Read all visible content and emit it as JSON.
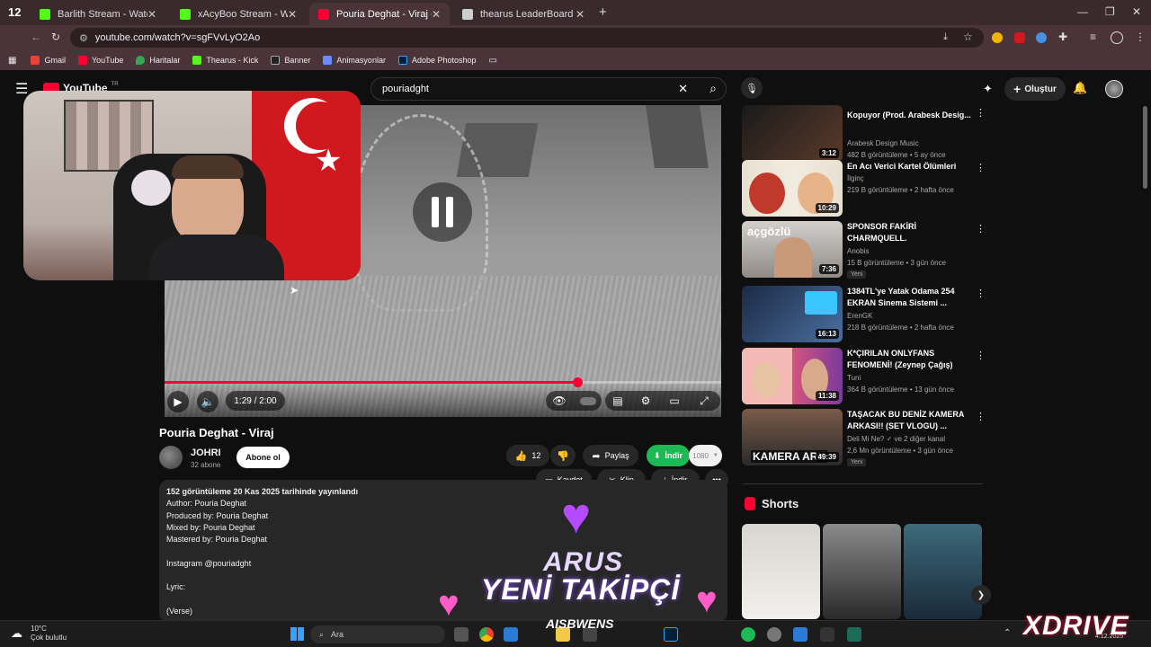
{
  "browser": {
    "tabs": [
      {
        "title": "Barlith Stream - Watch Live on",
        "color": "#53fc18"
      },
      {
        "title": "xAcyBoo Stream - Watch Live o",
        "color": "#53fc18"
      },
      {
        "title": "Pouria Deghat - Viraj - YouT",
        "color": "#ff0033"
      },
      {
        "title": "thearus LeaderBoard | The best",
        "color": "#cccccc"
      }
    ],
    "url": "youtube.com/watch?v=sgFVvLyO2Ao",
    "bookmarks": [
      "Gmail",
      "YouTube",
      "Haritalar",
      "Thearus - Kick",
      "Banner",
      "Animasyonlar",
      "Adobe Photoshop"
    ],
    "tab_counter": "12"
  },
  "youtube": {
    "logo": "YouTube",
    "logo_region": "TR",
    "search_value": "pouriadght",
    "create_label": "Oluştur"
  },
  "player": {
    "time": "1:29 / 2:00",
    "progress": 0.742
  },
  "video": {
    "title": "Pouria Deghat - Viraj",
    "channel": "JOHRI",
    "subscribers": "32 abone",
    "subscribe_label": "Abone ol",
    "likes": "12",
    "share_label": "Paylaş",
    "download_green_label": "İndir",
    "quality": "1080",
    "save_label": "Kaydet",
    "clip_label": "Klip",
    "download_label": "İndir"
  },
  "description": {
    "meta": "152 görüntüleme  20 Kas 2025 tarihinde yayınlandı",
    "lines": [
      "Author: Pouria Deghat",
      "Produced by: Pouria Deghat",
      "Mixed by: Pouria Deghat",
      "Mastered by: Pouria Deghat",
      "",
      "Instagram @pouriadght",
      "",
      "Lyric:",
      "",
      "(Verse)"
    ]
  },
  "alert": {
    "name": "ARUS",
    "text": "YENİ TAKİPÇİ",
    "sub": "AISBWENS"
  },
  "recommendations": [
    {
      "title": "Kopuyor (Prod. Arabesk Desig...",
      "channel": "Arabesk Design Music",
      "stats": "482 B görüntüleme • 5 ay önce",
      "duration": "3:12",
      "badge": ""
    },
    {
      "title": "En Acı Verici Kartel Ölümleri",
      "channel": "İlginç",
      "stats": "219 B görüntüleme • 2 hafta önce",
      "duration": "10:29",
      "badge": ""
    },
    {
      "title": "SPONSOR FAKİRİ CHARMQUELL.",
      "channel": "Anobis",
      "stats": "15 B görüntüleme • 3 gün önce",
      "duration": "7:36",
      "badge": "Yeni"
    },
    {
      "title": "1384TL'ye Yatak Odama 254 EKRAN Sinema Sistemi ...",
      "channel": "ErenGK",
      "stats": "218 B görüntüleme • 2 hafta önce",
      "duration": "16:13",
      "badge": ""
    },
    {
      "title": "K*ÇIRILAN ONLYFANS FENOMENİ! (Zeynep Çağış)",
      "channel": "Tuni",
      "stats": "364 B görüntüleme • 13 gün önce",
      "duration": "11:38",
      "badge": ""
    },
    {
      "title": "TAŞACAK BU DENİZ KAMERA ARKASI!! (SET VLOGU) ...",
      "channel": "Deli Mi Ne? ✓ ve 2 diğer kanal",
      "stats": "2,6 Mn görüntüleme • 3 gün önce",
      "duration": "49:39",
      "badge": "Yeni"
    }
  ],
  "thumb_captions": {
    "acgozlu": "açgözlü",
    "kamera": "KAMERA ARK"
  },
  "shorts": {
    "label": "Shorts"
  },
  "taskbar": {
    "temp": "10°C",
    "weather": "Çok bulutlu",
    "search": "Ara",
    "date": "4.12.2025"
  },
  "overlay": {
    "brand": "XDRIVE"
  }
}
